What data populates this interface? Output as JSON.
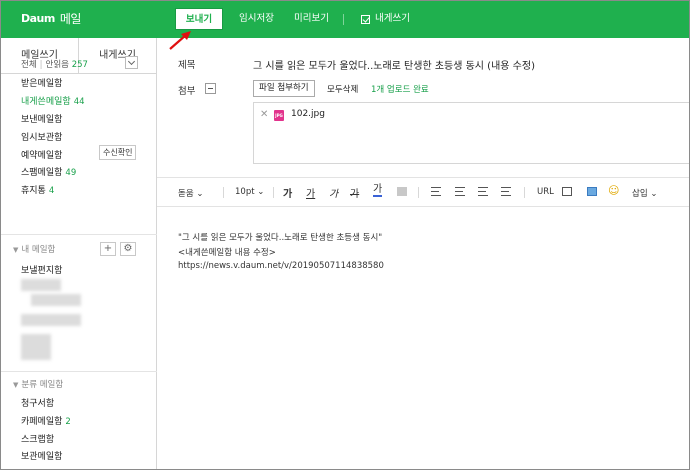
{
  "header": {
    "brand": "Daum",
    "service": "메일",
    "send_label": "보내기",
    "save_label": "임시저장",
    "preview_label": "미리보기",
    "self_label": "내게쓰기"
  },
  "sidebar": {
    "tabs": [
      "메일쓰기",
      "내게쓰기"
    ],
    "all_label": "전체",
    "unread_label": "안읽음",
    "unread_count": "257",
    "folders": [
      {
        "label": "받은메일함",
        "count": ""
      },
      {
        "label": "내게쓴메일함",
        "count": "44"
      },
      {
        "label": "보낸메일함",
        "count": ""
      },
      {
        "label": "임시보관함",
        "count": ""
      },
      {
        "label": "예약메일함",
        "count": ""
      },
      {
        "label": "스팸메일함",
        "count": "49"
      },
      {
        "label": "휴지통",
        "count": "4"
      }
    ],
    "receipt_button": "수신확인",
    "my_mailbox_title": "내 메일함",
    "my_mailbox_items": [
      "보낼편지함"
    ],
    "category_title": "분류 메일함",
    "category_items": [
      {
        "label": "청구서함",
        "count": ""
      },
      {
        "label": "카페메일함",
        "count": "2"
      },
      {
        "label": "스크랩함",
        "count": ""
      },
      {
        "label": "보관메일함",
        "count": ""
      }
    ]
  },
  "compose": {
    "subject_label": "제목",
    "subject_value": "그 시를 읽은 모두가 울었다..노래로 탄생한 초등생 동시 (내용 수정)",
    "attach_label": "첨부",
    "attach_button": "파일 첨부하기",
    "delete_all": "모두삭제",
    "upload_status": "1개 업로드 완료",
    "file_name": "102.jpg"
  },
  "toolbar": {
    "font": "돋움",
    "size": "10pt",
    "bold": "가",
    "underline": "가",
    "italic": "가",
    "strike": "가",
    "color": "가",
    "url": "URL",
    "insert": "삽입"
  },
  "body": {
    "lines": [
      "\"그 시를 읽은 모두가 울었다..노래로 탄생한 초등생 동시\"",
      "<내게쓴메일함 내용 수정>",
      "https://news.v.daum.net/v/20190507114838580"
    ]
  },
  "colors": {
    "brand_green": "#1fb04e",
    "count_green": "#18a04a",
    "file_pink": "#e2338c"
  }
}
